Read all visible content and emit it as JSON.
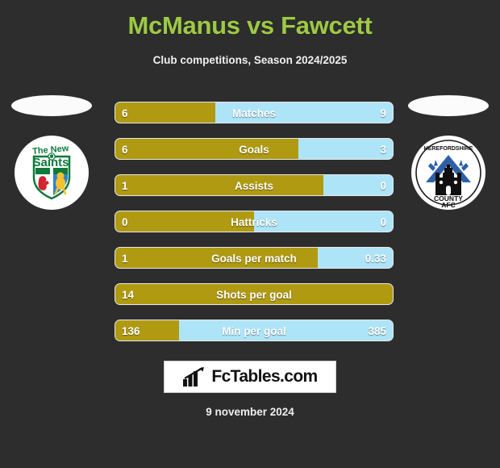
{
  "header": {
    "title": "McManus vs Fawcett",
    "subtitle": "Club competitions, Season 2024/2025",
    "title_color": "#9ec945"
  },
  "teams": {
    "home": {
      "name": "The New Saints",
      "crest_lines": [
        "The New",
        "Saints"
      ],
      "logo_icon": "tns-crest-icon"
    },
    "away": {
      "name": "Herefordshire County AFC",
      "crest_lines": [
        "HEREFORDSHIRE",
        "COUNTY",
        "AFC"
      ],
      "logo_icon": "hereford-crest-icon"
    }
  },
  "colors": {
    "background": "#2d2d2d",
    "home_bar": "#b09a12",
    "away_bar": "#aee4f8",
    "accent": "#9ec945"
  },
  "chart_data": {
    "type": "bar",
    "title": "McManus vs Fawcett",
    "subtitle": "Club competitions, Season 2024/2025",
    "comparison": "two-player head-to-head horizontal split bars",
    "categories": [
      "Matches",
      "Goals",
      "Assists",
      "Hattricks",
      "Goals per match",
      "Shots per goal",
      "Min per goal"
    ],
    "series": [
      {
        "name": "McManus",
        "values": [
          "6",
          "6",
          "1",
          "0",
          "1",
          "14",
          "136"
        ]
      },
      {
        "name": "Fawcett",
        "values": [
          "9",
          "3",
          "0",
          "0",
          "0.33",
          "",
          "385"
        ]
      }
    ],
    "rows": [
      {
        "label": "Matches",
        "home": "6",
        "away": "9",
        "home_pct": 36
      },
      {
        "label": "Goals",
        "home": "6",
        "away": "3",
        "home_pct": 66
      },
      {
        "label": "Assists",
        "home": "1",
        "away": "0",
        "home_pct": 75
      },
      {
        "label": "Hattricks",
        "home": "0",
        "away": "0",
        "home_pct": 50
      },
      {
        "label": "Goals per match",
        "home": "1",
        "away": "0.33",
        "home_pct": 73
      },
      {
        "label": "Shots per goal",
        "home": "14",
        "away": "",
        "home_pct": 100
      },
      {
        "label": "Min per goal",
        "home": "136",
        "away": "385",
        "home_pct": 23
      }
    ]
  },
  "footer": {
    "brand": "FcTables.com",
    "brand_icon": "bar-chart-arrow-icon",
    "date": "9 november 2024"
  }
}
